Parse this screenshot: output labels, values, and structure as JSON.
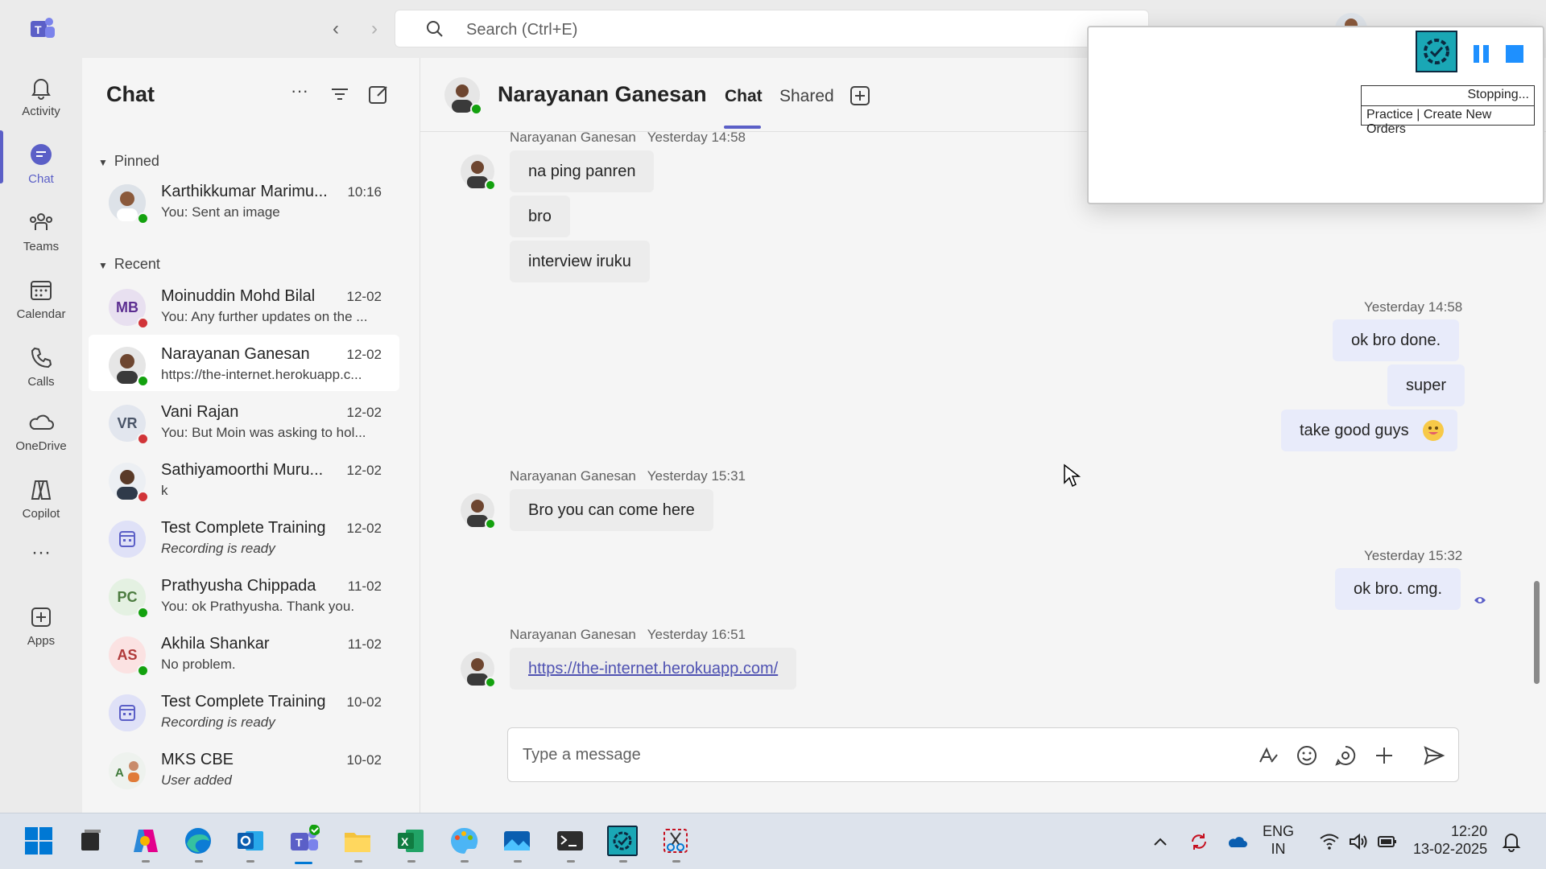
{
  "search": {
    "placeholder": "Search (Ctrl+E)"
  },
  "rail": {
    "items": [
      {
        "label": "Activity"
      },
      {
        "label": "Chat"
      },
      {
        "label": "Teams"
      },
      {
        "label": "Calendar"
      },
      {
        "label": "Calls"
      },
      {
        "label": "OneDrive"
      },
      {
        "label": "Copilot"
      },
      {
        "label": "Apps"
      }
    ],
    "accent": "#5b5fc7"
  },
  "chatlist": {
    "title": "Chat",
    "pinned_label": "Pinned",
    "recent_label": "Recent",
    "pinned": [
      {
        "name": "Karthikkumar Marimu...",
        "time": "10:16",
        "preview": "You: Sent an image",
        "presence": "available"
      }
    ],
    "recent": [
      {
        "name": "Moinuddin Mohd Bilal",
        "initials": "MB",
        "time": "12-02",
        "preview": "You: Any further updates on the ...",
        "presence": "busy"
      },
      {
        "name": "Narayanan Ganesan",
        "time": "12-02",
        "preview": "https://the-internet.herokuapp.c...",
        "presence": "available"
      },
      {
        "name": "Vani Rajan",
        "initials": "VR",
        "time": "12-02",
        "preview": "You: But Moin was asking to hol...",
        "presence": "busy"
      },
      {
        "name": "Sathiyamoorthi Muru...",
        "time": "12-02",
        "preview": "k",
        "presence": "busy"
      },
      {
        "name": "Test Complete Training",
        "time": "12-02",
        "preview": "Recording is ready"
      },
      {
        "name": "Prathyusha Chippada",
        "initials": "PC",
        "time": "11-02",
        "preview": "You: ok Prathyusha. Thank you.",
        "presence": "available"
      },
      {
        "name": "Akhila Shankar",
        "initials": "AS",
        "time": "11-02",
        "preview": "No problem.",
        "presence": "available"
      },
      {
        "name": "Test Complete Training",
        "time": "10-02",
        "preview": "Recording is ready"
      },
      {
        "name": "MKS CBE",
        "time": "10-02",
        "preview": "User added"
      }
    ]
  },
  "conversation": {
    "name": "Narayanan Ganesan",
    "tabs": [
      "Chat",
      "Shared"
    ],
    "groups": [
      {
        "sender": "Narayanan Ganesan",
        "time": "Yesterday 14:58",
        "messages": [
          "na ping panren",
          "bro",
          "interview iruku"
        ]
      },
      {
        "time": "Yesterday 14:58",
        "messages": [
          "ok bro done.",
          "super",
          "take good guys"
        ]
      },
      {
        "sender": "Narayanan Ganesan",
        "time": "Yesterday 15:31",
        "messages": [
          "Bro you can come here"
        ]
      },
      {
        "time": "Yesterday 15:32",
        "messages": [
          "ok bro. cmg."
        ]
      },
      {
        "sender": "Narayanan Ganesan",
        "time": "Yesterday 16:51",
        "messages": [
          "https://the-internet.herokuapp.com/"
        ]
      }
    ],
    "composer_placeholder": "Type a message"
  },
  "overlay": {
    "status": "Stopping...",
    "task": "Practice | Create New Orders"
  },
  "taskbar": {
    "lang_top": "ENG",
    "lang_bottom": "IN",
    "time": "12:20",
    "date": "13-02-2025"
  }
}
